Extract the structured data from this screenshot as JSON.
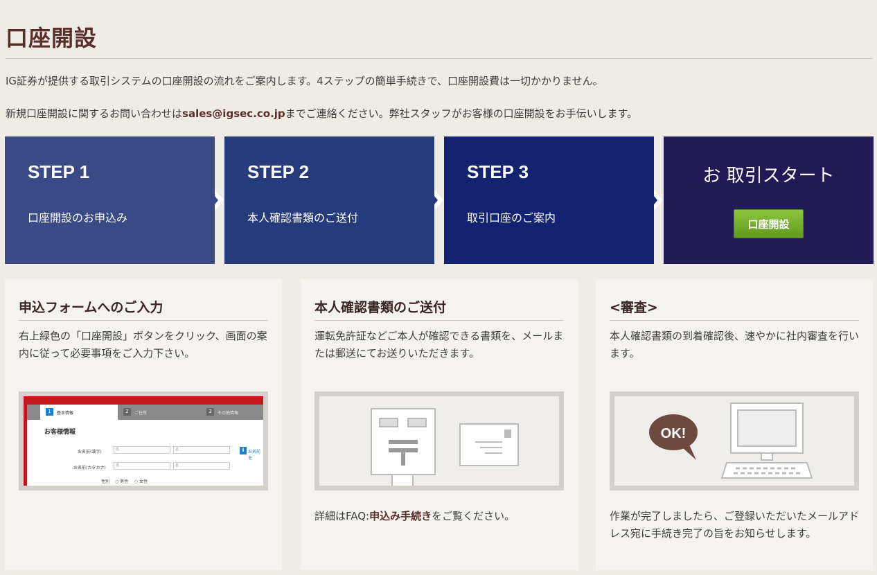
{
  "header": {
    "title": "口座開設"
  },
  "intro": {
    "line1": "IG証券が提供する取引システムの口座開設の流れをご案内します。4ステップの簡単手続きで、口座開設費は一切かかりません。",
    "line2_prefix": "新規口座開設に関するお問い合わせは",
    "line2_email": "sales@igsec.co.jp",
    "line2_suffix": "までご連絡ください。弊社スタッフがお客様の口座開設をお手伝いします。"
  },
  "steps": [
    {
      "title": "STEP 1",
      "desc": "口座開設のお申込み"
    },
    {
      "title": "STEP 2",
      "desc": "本人確認書類のご送付"
    },
    {
      "title": "STEP 3",
      "desc": "取引口座のご案内"
    }
  ],
  "start": {
    "title": "お 取引スタート",
    "button": "口座開設"
  },
  "cards": [
    {
      "title": "申込フォームへのご入力",
      "body": "右上緑色の「口座開設」ボタンをクリック、画面の案内に従って必要事項をご入力下さい。",
      "form": {
        "tab1_num": "1",
        "tab1": "基本情報",
        "tab2_num": "2",
        "tab2": "ご住所",
        "tab3_num": "3",
        "tab3": "その他情報",
        "section": "お客様情報",
        "row1": "お名前(漢字)",
        "row2": "お名前(カタカナ)",
        "row3": "性別",
        "sei": "姓",
        "mei": "名",
        "male": "男性",
        "female": "女性",
        "info_icon": "i",
        "info_text": "お名前を"
      }
    },
    {
      "title": "本人確認書類のご送付",
      "body": "運転免許証などご本人が確認できる書類を、メールまたは郵送にてお送りいただきます。",
      "foot_prefix": "詳細はFAQ:",
      "foot_link": "申込み手続き",
      "foot_suffix": "をご覧ください。"
    },
    {
      "title": "<審査>",
      "body": "本人確認書類の到着確認後、速やかに社内審査を行います。",
      "bubble": "OK!",
      "foot": "作業が完了しましたら、ご登録いただいたメールアドレス宛に手続き完了の旨をお知らせします。"
    }
  ],
  "colors": {
    "title_brown": "#5a2f2a",
    "step1": "#394a87",
    "step2": "#263a7c",
    "step3": "#142272",
    "start": "#221a57",
    "button_green": "#6cae2a"
  }
}
